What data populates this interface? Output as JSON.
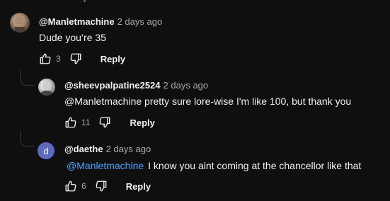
{
  "comments": [
    {
      "author": "@Manletmachine",
      "time": "2 days ago",
      "mention": "",
      "text": "Dude you’re 35",
      "likes": "3",
      "reply_label": "Reply",
      "avatar_color": "#7a6a5a"
    },
    {
      "author": "@sheevpalpatine2524",
      "time": "2 days ago",
      "mention": "",
      "text": "@Manletmachine pretty sure lore-wise I'm like 100, but thank you",
      "likes": "11",
      "reply_label": "Reply",
      "avatar_color": "#c9c9c9"
    },
    {
      "author": "@daethe",
      "time": "2 days ago",
      "mention": "@Manletmachine",
      "text": "I know you aint coming at the chancellor like that",
      "likes": "6",
      "reply_label": "Reply",
      "avatar_letter": "d",
      "avatar_color": "#5c6bc0"
    }
  ],
  "colors": {
    "background": "#0f0f0f",
    "text": "#f1f1f1",
    "secondary_text": "#aaaaaa",
    "mention": "#3ea6ff"
  }
}
